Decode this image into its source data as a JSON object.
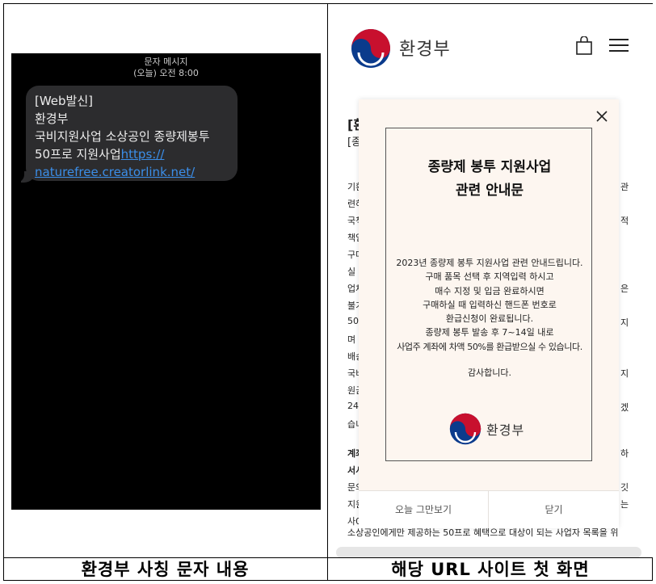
{
  "captions": {
    "left": "환경부 사칭 문자 내용",
    "right": "해당 URL 사이트 첫 화면"
  },
  "sms": {
    "header_title": "문자 메시지",
    "header_time": "(오늘) 오전 8:00",
    "message_lines": [
      "[Web발신]",
      "환경부",
      "국비지원사업 소상공인 종량제봉투"
    ],
    "message_prefix_line": "50프로 지원사업",
    "link_part1": "https://",
    "link_part2": "naturefree.creatorlink.net/"
  },
  "site": {
    "brand": "환경부",
    "popup": {
      "title_line1": "종량제 봉투 지원사업",
      "title_line2": "관련 안내문",
      "body_lines": [
        "2023년 종량제 봉투 지원사업 관련 안내드립니다.",
        "구매 품목 선택 후 지역입력 하시고",
        "매수 지정 및 입금 완료하시면",
        "구매하실 때 입력하신 핸드폰 번호로",
        "환급신청이 완료됩니다.",
        "종량제 봉투 발송 후 7~14일 내로",
        "사업주 계좌에 차액 50%를 환급받으실 수 있습니다."
      ],
      "thanks": "감사합니다.",
      "brand": "환경부",
      "btn_dismiss_today": "오늘 그만보기",
      "btn_close": "닫기"
    },
    "bg_left": [
      "[환",
      "[종",
      "기환",
      "련하",
      "국책",
      "책임",
      "구매",
      "실 !",
      "업체",
      "불가",
      "50.",
      "며 ",
      "배송",
      "국비",
      "원금",
      "24.",
      "습니",
      "계좌",
      "서시",
      "문의",
      "지원",
      "사0"
    ],
    "bg_right": [
      "관",
      "적",
      "",
      "",
      "은",
      "",
      "지",
      "",
      "",
      "지",
      "",
      "겠",
      "",
      "하",
      "",
      "깃",
      "는"
    ],
    "bottom_line": "소상공인에게만 제공하는 50프로 혜택으로 대상이 되는 사업자 목록을 위"
  },
  "colors": {
    "sms_background": "#000000",
    "bubble": "#2c2c2e",
    "link": "#3b8ee8",
    "popup_background": "#fdf6f0",
    "logo_red": "#c8102e",
    "logo_blue": "#0b3b8c"
  }
}
